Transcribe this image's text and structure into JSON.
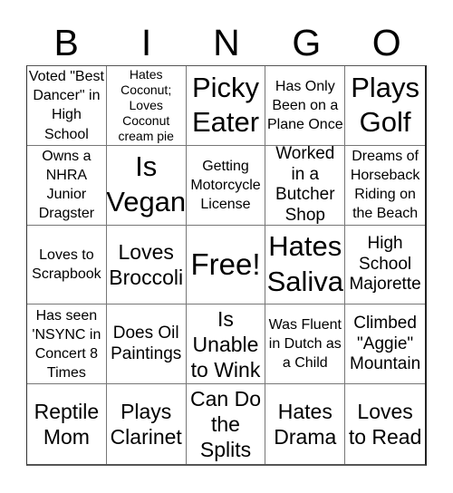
{
  "header": {
    "letters": [
      "B",
      "I",
      "N",
      "G",
      "O"
    ]
  },
  "board": {
    "rows": [
      [
        "Voted \"Best Dancer\" in High School",
        "Hates Coconut; Loves Coconut cream pie",
        "Picky Eater",
        "Has Only Been on a Plane Once",
        "Plays Golf"
      ],
      [
        "Owns a NHRA Junior Dragster",
        "Is Vegan",
        "Getting Motorcycle License",
        "Worked in a Butcher Shop",
        "Dreams of Horseback Riding on the Beach"
      ],
      [
        "Loves to Scrapbook",
        "Loves Broccoli",
        "Free!",
        "Hates Saliva",
        "High School Majorette"
      ],
      [
        "Has seen 'NSYNC in Concert 8 Times",
        "Does Oil Paintings",
        "Is Unable to Wink",
        "Was Fluent in Dutch as a Child",
        "Climbed \"Aggie\" Mountain"
      ],
      [
        "Reptile Mom",
        "Plays Clarinet",
        "Can Do the Splits",
        "Hates Drama",
        "Loves to Read"
      ]
    ]
  }
}
